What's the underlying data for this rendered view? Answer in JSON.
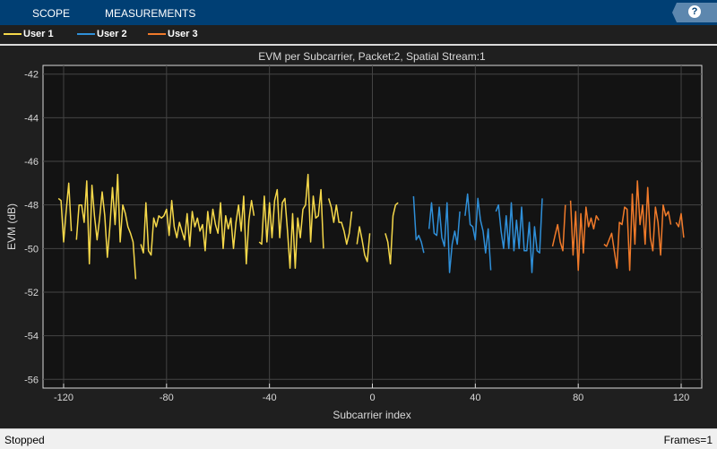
{
  "toolbar": {
    "tabs": [
      "SCOPE",
      "MEASUREMENTS"
    ],
    "help": "?"
  },
  "status": {
    "state": "Stopped",
    "frames": "Frames=1"
  },
  "colors": {
    "header": "#003f74",
    "plot_bg": "#131313",
    "grid": "#444444"
  },
  "chart_data": {
    "type": "line",
    "title": "EVM per Subcarrier, Packet:2, Spatial Stream:1",
    "xlabel": "Subcarrier index",
    "ylabel": "EVM (dB)",
    "xlim": [
      -128,
      128
    ],
    "ylim": [
      -56.4,
      -41.6
    ],
    "xticks": [
      -120,
      -80,
      -40,
      0,
      40,
      80,
      120
    ],
    "yticks": [
      -42,
      -44,
      -46,
      -48,
      -50,
      -52,
      -54,
      -56
    ],
    "grid": true,
    "legend_position": "top-left",
    "series": [
      {
        "name": "User 1",
        "color": "#f5d84a",
        "x_start": -122,
        "values": [
          -47.7,
          -47.8,
          -49.7,
          -48.3,
          -47.0,
          -49.2,
          null,
          -49.6,
          -48.0,
          -48.0,
          -48.8,
          -46.9,
          -50.7,
          -47.1,
          -48.5,
          -49.6,
          -48.6,
          -47.4,
          -48.5,
          -50.4,
          -49.0,
          -47.2,
          -48.9,
          -46.6,
          -49.7,
          -48.0,
          -48.4,
          -49.0,
          -49.3,
          -49.7,
          -51.4,
          null,
          -49.8,
          -50.2,
          -47.9,
          -50.1,
          -50.3,
          -48.6,
          -49.0,
          -48.5,
          -48.6,
          -48.5,
          -48.2,
          -49.4,
          -47.8,
          -49.0,
          -49.5,
          -48.8,
          -49.2,
          -49.6,
          -48.4,
          -49.9,
          -48.3,
          -49.0,
          -48.6,
          -49.2,
          -48.9,
          -50.1,
          -48.3,
          -49.3,
          -48.2,
          -48.9,
          -49.3,
          -47.9,
          -50.0,
          -48.5,
          -49.1,
          -48.6,
          -50.0,
          -48.8,
          -48.0,
          -49.2,
          -47.6,
          -50.7,
          -48.7,
          -47.8,
          -48.5,
          null,
          -49.7,
          -49.8,
          -47.6,
          -49.7,
          -47.9,
          -49.5,
          -47.8,
          -47.3,
          -49.5,
          -47.9,
          -47.7,
          -49.2,
          -50.9,
          -48.4,
          -50.9,
          -48.6,
          -49.5,
          -48.2,
          -48.0,
          -46.6,
          -49.7,
          -47.6,
          -48.6,
          -48.5,
          -47.3,
          -50.0,
          null,
          -47.7,
          -48.1,
          -48.8,
          -48.0,
          -48.8,
          -48.8,
          -49.2,
          -49.8,
          -49.3,
          -48.3,
          null,
          -49.8,
          -49.0,
          -49.6,
          -50.3,
          -50.6,
          -49.3,
          null,
          null,
          null,
          null,
          null,
          -49.3,
          -49.7,
          -50.7,
          -48.5,
          -48.0,
          -47.9
        ]
      },
      {
        "name": "User 2",
        "color": "#2f8fd8",
        "x_start": 16,
        "values": [
          -47.6,
          -49.6,
          -49.4,
          -49.7,
          -50.2,
          null,
          -49.1,
          -47.9,
          -49.3,
          -49.4,
          -48.1,
          -49.5,
          -49.9,
          -47.9,
          -51.1,
          -49.8,
          -49.2,
          -49.8,
          -48.3,
          null,
          -48.5,
          -47.5,
          -48.9,
          -49.0,
          -49.6,
          -47.7,
          -48.7,
          -49.2,
          -50.2,
          -49.1,
          -51.0,
          null,
          -48.3,
          -48.0,
          -49.2,
          -50.0,
          -48.5,
          -50.0,
          -47.9,
          -50.1,
          -48.7,
          -50.0,
          -48.1,
          -50.1,
          -50.1,
          -48.8,
          -51.1,
          -49.0,
          -50.1,
          -50.2,
          -47.7
        ]
      },
      {
        "name": "User 3",
        "color": "#f07a2a",
        "x_start": 70,
        "values": [
          -49.9,
          -49.4,
          -48.9,
          -49.7,
          -50.1,
          -48.0,
          null,
          -47.8,
          -50.3,
          -48.3,
          -51.0,
          -48.4,
          -50.2,
          -48.1,
          -49.0,
          -48.6,
          -49.1,
          -48.5,
          -48.7,
          null,
          -49.8,
          -49.9,
          -49.6,
          -49.3,
          -50.1,
          -50.9,
          -48.8,
          -48.9,
          -48.1,
          -48.2,
          -51.0,
          -47.5,
          -49.8,
          -46.9,
          -48.9,
          -48.0,
          -49.8,
          -47.2,
          -49.5,
          -50.1,
          -48.1,
          -48.8,
          -50.3,
          -48.0,
          -48.5,
          -48.3,
          -48.9,
          null,
          -48.8,
          -49.0,
          -48.4,
          -49.5
        ]
      }
    ]
  }
}
